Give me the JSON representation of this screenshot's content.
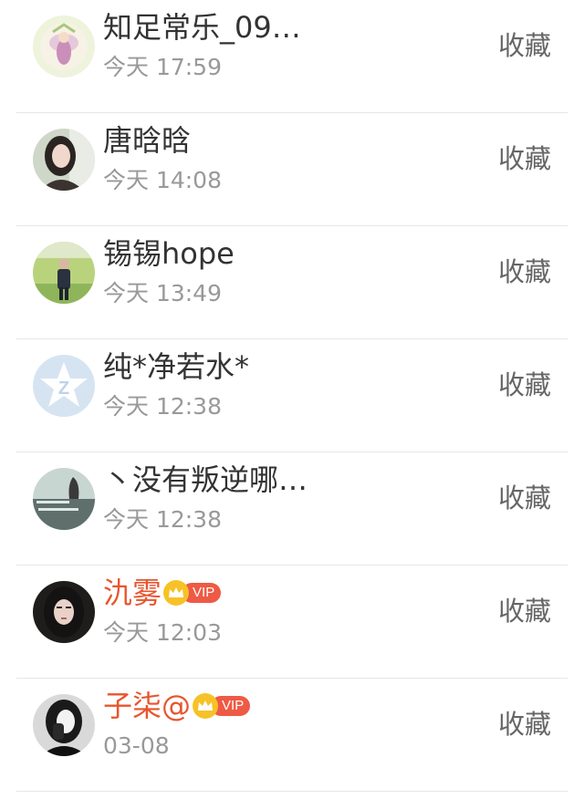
{
  "fav_label": "收藏",
  "items": [
    {
      "name": "知足常乐_09…",
      "time": "今天 17:59",
      "vip": false
    },
    {
      "name": "唐晗晗",
      "time": "今天 14:08",
      "vip": false
    },
    {
      "name": "锡锡hope",
      "time": "今天 13:49",
      "vip": false
    },
    {
      "name": "纯*净若水*",
      "time": "今天 12:38",
      "vip": false
    },
    {
      "name": "丶没有叛逆哪…",
      "time": "今天 12:38",
      "vip": false
    },
    {
      "name": "氿雾",
      "time": "今天 12:03",
      "vip": true,
      "vip_label": "VIP"
    },
    {
      "name": "子柒@",
      "time": "03-08",
      "vip": true,
      "vip_label": "VIP"
    }
  ],
  "colors": {
    "vip_name": "#e8552e",
    "vip_badge": "#ee5a45",
    "vip_crown": "#f7c227"
  }
}
